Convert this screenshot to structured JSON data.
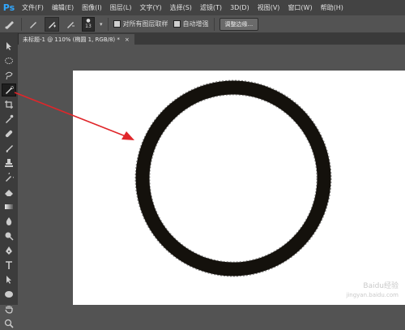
{
  "app": {
    "logo": "Ps"
  },
  "menu": [
    "文件(F)",
    "编辑(E)",
    "图像(I)",
    "图层(L)",
    "文字(Y)",
    "选择(S)",
    "滤镜(T)",
    "3D(D)",
    "视图(V)",
    "窗口(W)",
    "帮助(H)"
  ],
  "options": {
    "brush_size": "13",
    "sample_all_layers": "对所有图层取样",
    "auto_enhance": "自动增强",
    "refine_edge": "调整边缘..."
  },
  "document": {
    "tab_title": "未标题-1 @ 110% (椭圆 1, RGB/8) *",
    "close": "×"
  },
  "watermark": {
    "line1": "Baidu经验",
    "line2": "jingyan.baidu.com"
  },
  "colors": {
    "accent": "#31a8ff",
    "ring": "#14110c",
    "arrow": "#e0262a"
  }
}
